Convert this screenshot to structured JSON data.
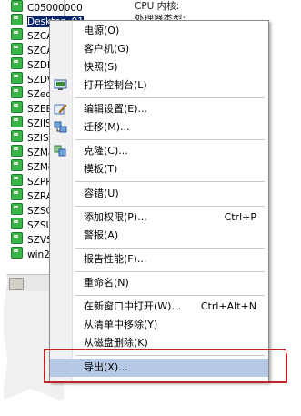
{
  "tree": {
    "items": [
      {
        "label": "C05000000",
        "selected": false
      },
      {
        "label": "Desktop_01",
        "selected": true
      },
      {
        "label": "SZCA",
        "selected": false
      },
      {
        "label": "SZCA",
        "selected": false
      },
      {
        "label": "SZDH",
        "selected": false
      },
      {
        "label": "SZDV",
        "selected": false
      },
      {
        "label": "SZecs",
        "selected": false
      },
      {
        "label": "SZEE",
        "selected": false
      },
      {
        "label": "SZIIS",
        "selected": false
      },
      {
        "label": "SZISA",
        "selected": false
      },
      {
        "label": "SZMa",
        "selected": false
      },
      {
        "label": "SZMo",
        "selected": false
      },
      {
        "label": "SZPR",
        "selected": false
      },
      {
        "label": "SZRA",
        "selected": false
      },
      {
        "label": "SZSQ",
        "selected": false
      },
      {
        "label": "SZSU",
        "selected": false
      },
      {
        "label": "SZVS",
        "selected": false
      },
      {
        "label": "win20",
        "selected": false
      }
    ]
  },
  "detail": {
    "line1": "CPU 内核:",
    "line2": "处理器类型:"
  },
  "menu": {
    "items": [
      {
        "label": "电源(O)",
        "shortcut": "",
        "icon": ""
      },
      {
        "label": "客户机(G)",
        "shortcut": "",
        "icon": ""
      },
      {
        "label": "快照(S)",
        "shortcut": "",
        "icon": ""
      },
      {
        "label": "打开控制台(L)",
        "shortcut": "",
        "icon": "console-icon"
      },
      {
        "label": "编辑设置(E)...",
        "shortcut": "",
        "icon": "edit-settings-icon"
      },
      {
        "label": "迁移(M)...",
        "shortcut": "",
        "icon": "migrate-icon"
      },
      {
        "label": "克隆(C)...",
        "shortcut": "",
        "icon": "clone-icon"
      },
      {
        "label": "模板(T)",
        "shortcut": "",
        "icon": ""
      },
      {
        "label": "容错(U)",
        "shortcut": "",
        "icon": ""
      },
      {
        "label": "添加权限(P)...",
        "shortcut": "Ctrl+P",
        "icon": ""
      },
      {
        "label": "警报(A)",
        "shortcut": "",
        "icon": ""
      },
      {
        "label": "报告性能(F)...",
        "shortcut": "",
        "icon": ""
      },
      {
        "label": "重命名(N)",
        "shortcut": "",
        "icon": ""
      },
      {
        "label": "在新窗口中打开(W)...",
        "shortcut": "Ctrl+Alt+N",
        "icon": ""
      },
      {
        "label": "从清单中移除(Y)",
        "shortcut": "",
        "icon": ""
      },
      {
        "label": "从磁盘删除(K)",
        "shortcut": "",
        "icon": ""
      },
      {
        "label": "导出(X)...",
        "shortcut": "",
        "icon": ""
      }
    ]
  },
  "colors": {
    "highlight_box": "#c0232a",
    "menu_highlight": "#b5c8e6",
    "vm_icon": "#39b54a"
  }
}
